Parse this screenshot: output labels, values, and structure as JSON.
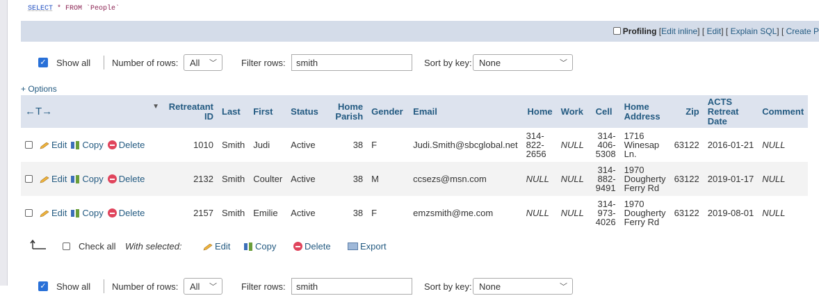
{
  "query": {
    "keyword": "SELECT",
    "rest": " * FROM `People`"
  },
  "sql_bar": {
    "profiling": "Profiling",
    "edit_inline": "Edit inline",
    "edit": "Edit",
    "explain": "Explain SQL",
    "create": "Create P"
  },
  "nav": {
    "show_all": "Show all",
    "show_all_checked": true,
    "number_of_rows_label": "Number of rows:",
    "number_of_rows_value": "All",
    "filter_label": "Filter rows:",
    "filter_value": "smith",
    "sort_label": "Sort by key:",
    "sort_value": "None"
  },
  "options_link": "+ Options",
  "table": {
    "control_header": "←T→",
    "columns": [
      {
        "l1": "Retreatant",
        "l2": "ID"
      },
      {
        "l1": "Last"
      },
      {
        "l1": "First"
      },
      {
        "l1": "Status"
      },
      {
        "l1": "Home",
        "l2": "Parish"
      },
      {
        "l1": "Gender"
      },
      {
        "l1": "Email"
      },
      {
        "l1": "Home"
      },
      {
        "l1": "Work"
      },
      {
        "l1": "Cell"
      },
      {
        "l1": "Home",
        "l2": "Address"
      },
      {
        "l1": "Zip"
      },
      {
        "l1": "ACTS",
        "l2": "Retreat",
        "l3": "Date"
      },
      {
        "l1": "Comment"
      }
    ],
    "actions": {
      "edit": "Edit",
      "copy": "Copy",
      "delete": "Delete"
    },
    "rows": [
      {
        "id": "1010",
        "last": "Smith",
        "first": "Judi",
        "status": "Active",
        "parish": "38",
        "gender": "F",
        "email": "Judi.Smith@sbcglobal.net",
        "home": [
          "314-",
          "822-",
          "2656"
        ],
        "work": "NULL",
        "cell": [
          "314-",
          "406-",
          "5308"
        ],
        "address": [
          "1716",
          "Winesap",
          "Ln."
        ],
        "zip": "63122",
        "date": "2016-01-21",
        "comment": "NULL"
      },
      {
        "id": "2132",
        "last": "Smith",
        "first": "Coulter",
        "status": "Active",
        "parish": "38",
        "gender": "M",
        "email": "ccsezs@msn.com",
        "home": [
          "NULL"
        ],
        "work": "NULL",
        "cell": [
          "314-",
          "882-",
          "9491"
        ],
        "address": [
          "1970",
          "Dougherty",
          "Ferry Rd"
        ],
        "zip": "63122",
        "date": "2019-01-17",
        "comment": "NULL"
      },
      {
        "id": "2157",
        "last": "Smith",
        "first": "Emilie",
        "status": "Active",
        "parish": "38",
        "gender": "F",
        "email": "emzsmith@me.com",
        "home": [
          "NULL"
        ],
        "work": "NULL",
        "cell": [
          "314-",
          "973-",
          "4026"
        ],
        "address": [
          "1970",
          "Dougherty",
          "Ferry Rd"
        ],
        "zip": "63122",
        "date": "2019-08-01",
        "comment": "NULL"
      }
    ]
  },
  "bulk": {
    "check_all": "Check all",
    "with_selected": "With selected:",
    "edit": "Edit",
    "copy": "Copy",
    "delete": "Delete",
    "export": "Export"
  }
}
